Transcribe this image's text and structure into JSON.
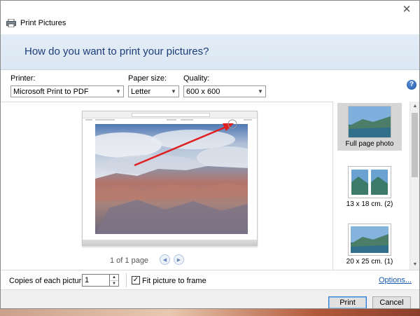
{
  "window": {
    "title": "Print Pictures",
    "close_symbol": "✕"
  },
  "banner": {
    "heading": "How do you want to print your pictures?"
  },
  "options": {
    "printer_label": "Printer:",
    "printer_value": "Microsoft Print to PDF",
    "paper_label": "Paper size:",
    "paper_value": "Letter",
    "quality_label": "Quality:",
    "quality_value": "600 x 600",
    "help_symbol": "?"
  },
  "preview": {
    "page_count": "1 of 1 page",
    "prev_symbol": "◀",
    "next_symbol": "▶"
  },
  "layouts": {
    "items": [
      {
        "label": "Full page photo",
        "selected": true
      },
      {
        "label": "13 x 18 cm. (2)",
        "selected": false
      },
      {
        "label": "20 x 25 cm. (1)",
        "selected": false
      }
    ],
    "scroll_up": "▲",
    "scroll_down": "▼"
  },
  "bottom": {
    "copies_label": "Copies of each picture:",
    "copies_value": "1",
    "spin_up": "▲",
    "spin_down": "▼",
    "fit_checked": true,
    "fit_check_symbol": "✓",
    "fit_label": "Fit picture to frame",
    "options_link": "Options..."
  },
  "footer": {
    "print_label": "Print",
    "cancel_label": "Cancel"
  },
  "colors": {
    "banner_text": "#1e3c78",
    "link": "#1a5ab5",
    "arrow": "#e02020",
    "banner_bg": "#dbe7f3"
  },
  "icons": {
    "title": "printer-icon",
    "help": "help-icon",
    "close": "close-icon",
    "arrow": "red-arrow-annotation"
  }
}
